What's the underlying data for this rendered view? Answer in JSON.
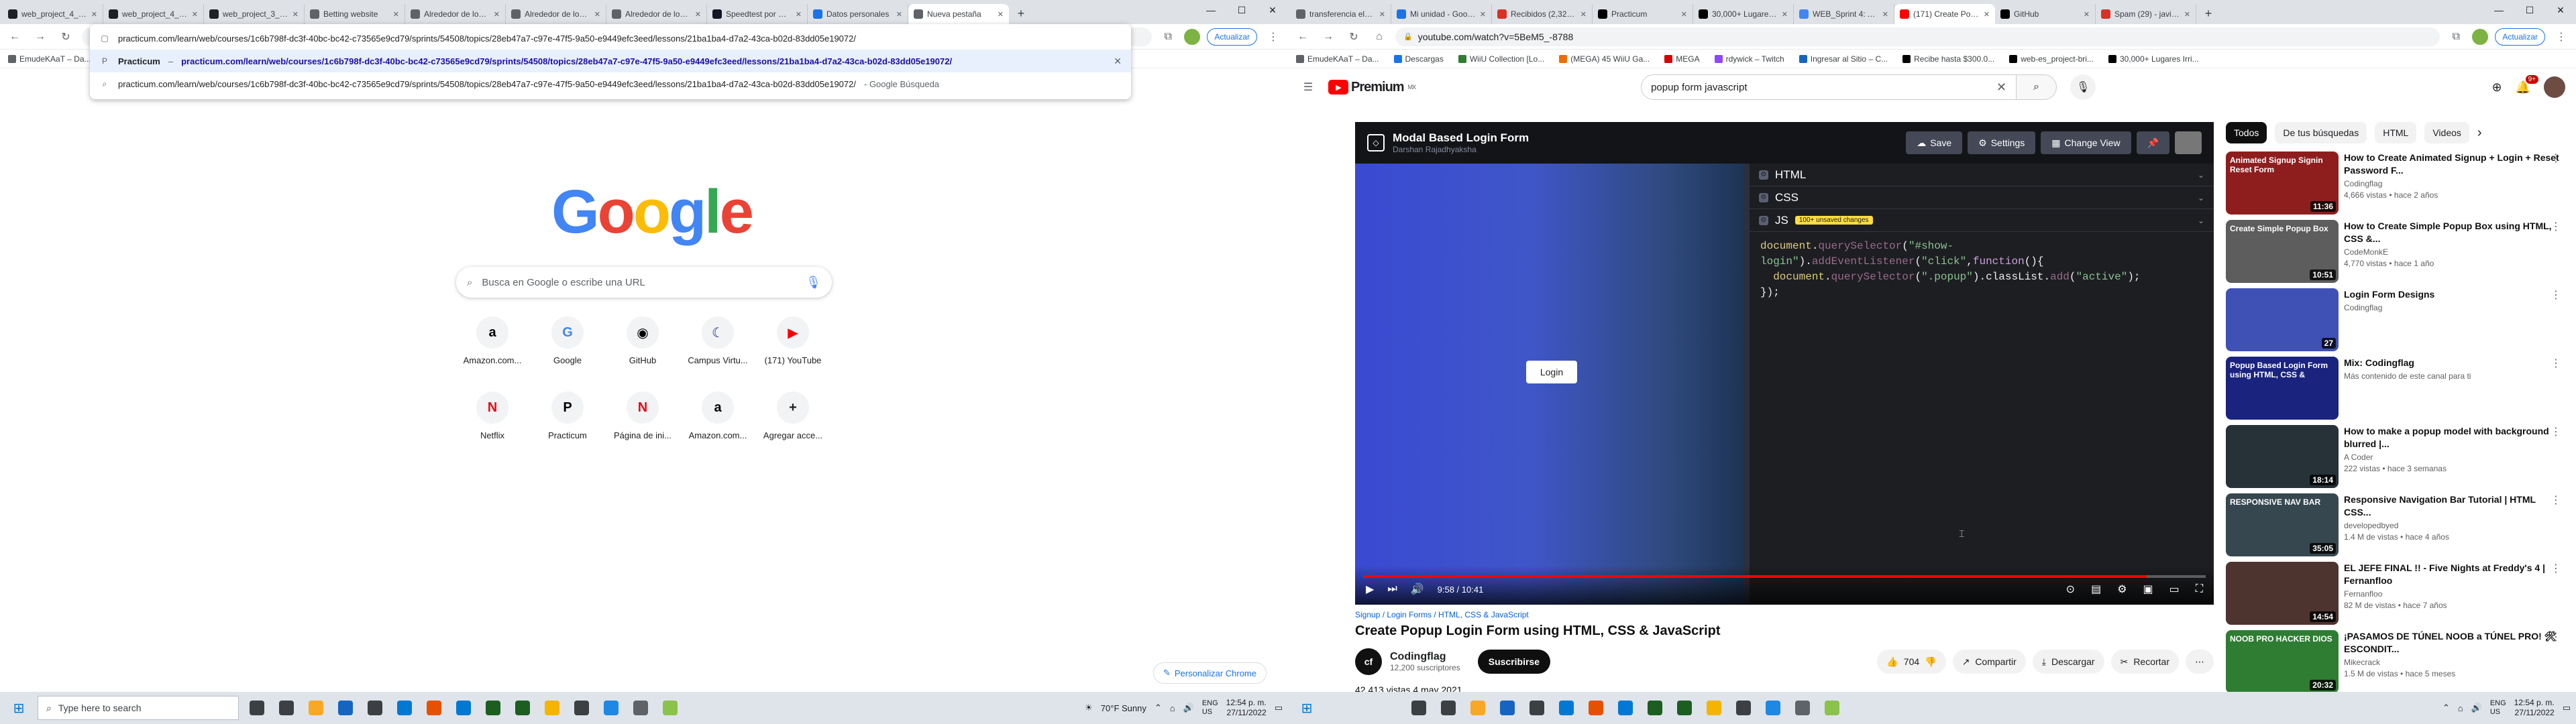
{
  "left": {
    "tabs": [
      {
        "title": "web_project_4_es...",
        "color": "#202124",
        "glyph": ""
      },
      {
        "title": "web_project_4_es...",
        "color": "#202124",
        "glyph": ""
      },
      {
        "title": "web_project_3_es...",
        "color": "#202124",
        "glyph": ""
      },
      {
        "title": "Betting website",
        "color": "#5f6368",
        "glyph": ""
      },
      {
        "title": "Alrededor de los E...",
        "color": "#5f6368",
        "glyph": ""
      },
      {
        "title": "Alrededor de los E...",
        "color": "#5f6368",
        "glyph": ""
      },
      {
        "title": "Alrededor de los E...",
        "color": "#5f6368",
        "glyph": ""
      },
      {
        "title": "Speedtest por Ook...",
        "color": "#141526",
        "glyph": ""
      },
      {
        "title": "Datos personales",
        "color": "#1a73e8",
        "glyph": ""
      },
      {
        "title": "Nueva pestaña",
        "color": "#5f6368",
        "glyph": ""
      }
    ],
    "omnibox_text": "practicum.com/learn/web/courses/1c6b798f-dc3f-40bc-bc42-c73565e9cd79/sprints/54508/topics/28eb47a7-c97e-47f5-9a50-e9449efc3eed/lessons/21ba1ba4-d7a2-43ca-b02d-83dd05e19072/",
    "dropdown": [
      {
        "icon": "P",
        "bold": "Practicum",
        "url": "practicum.com/learn/web/courses/1c6b798f-dc3f-40bc-bc42-c73565e9cd79/sprints/54508/topics/28eb47a7-c97e-47f5-9a50-e9449efc3eed/lessons/21ba1ba4-d7a2-43ca-b02d-83dd05e19072/",
        "dim": ""
      },
      {
        "icon": "⌕",
        "bold": "",
        "url": "practicum.com/learn/web/courses/1c6b798f-dc3f-40bc-bc42-c73565e9cd79/sprints/54508/topics/28eb47a7-c97e-47f5-9a50-e9449efc3eed/lessons/21ba1ba4-d7a2-43ca-b02d-83dd05e19072/",
        "dim": "- Google Búsqueda"
      }
    ],
    "bookmarks": [
      {
        "label": "EmudeKAaT – Da..."
      }
    ],
    "search_placeholder": "Busca en Google o escribe una URL",
    "shortcuts": [
      {
        "label": "Amazon.com...",
        "glyph": "a",
        "color": "#000"
      },
      {
        "label": "Google",
        "glyph": "G",
        "color": "#4285f4"
      },
      {
        "label": "GitHub",
        "glyph": "◉",
        "color": "#000"
      },
      {
        "label": "Campus Virtu...",
        "glyph": "☾",
        "color": "#1a237e"
      },
      {
        "label": "(171) YouTube",
        "glyph": "▶",
        "color": "#ff0000"
      },
      {
        "label": "Netflix",
        "glyph": "N",
        "color": "#e50914"
      },
      {
        "label": "Practicum",
        "glyph": "P",
        "color": "#000"
      },
      {
        "label": "Página de ini...",
        "glyph": "N",
        "color": "#e50914"
      },
      {
        "label": "Amazon.com...",
        "glyph": "a",
        "color": "#000"
      },
      {
        "label": "Agregar acce...",
        "glyph": "+",
        "color": "#202124"
      }
    ],
    "customize_label": "Personalizar Chrome",
    "update_label": "Actualizar"
  },
  "right": {
    "tabs": [
      {
        "title": "transferencia electrón...",
        "color": "#5f6368"
      },
      {
        "title": "Mi unidad - Google D...",
        "color": "#1a73e8"
      },
      {
        "title": "Recibidos (2,320) - ja...",
        "color": "#d93025"
      },
      {
        "title": "Practicum",
        "color": "#000"
      },
      {
        "title": "30,000+ Lugares Irrea...",
        "color": "#000"
      },
      {
        "title": "WEB_Sprint 4: Alrede...",
        "color": "#4285f4"
      },
      {
        "title": "(171) Create Popup L...",
        "color": "#ff0000"
      },
      {
        "title": "GitHub",
        "color": "#000"
      },
      {
        "title": "Spam (29) - javierca...",
        "color": "#d93025"
      }
    ],
    "omnibox_text": "youtube.com/watch?v=5BeM5_-8788",
    "update_label": "Actualizar",
    "bookmarks": [
      {
        "label": "EmudeKAaT – Da...",
        "color": "#5f6368"
      },
      {
        "label": "Descargas",
        "color": "#1a73e8"
      },
      {
        "label": "WiiU Collection [Lo...",
        "color": "#2e7d32"
      },
      {
        "label": "(MEGA) 45 WiiU Ga...",
        "color": "#ef6c00"
      },
      {
        "label": "MEGA",
        "color": "#d50000"
      },
      {
        "label": "rdywick – Twitch",
        "color": "#9146ff"
      },
      {
        "label": "Ingresar al Sitio – C...",
        "color": "#1565c0"
      },
      {
        "label": "Recibe hasta $300.0...",
        "color": "#000"
      },
      {
        "label": "web-es_project-bri...",
        "color": "#000"
      },
      {
        "label": "30,000+ Lugares Irri...",
        "color": "#000"
      }
    ],
    "search_query": "popup form javascript",
    "notif_count": "9+",
    "pen": {
      "title": "Modal Based Login Form",
      "author": "Darshan Rajadhyaksha",
      "save": "Save",
      "settings": "Settings",
      "change_view": "Change View",
      "panel_html": "HTML",
      "panel_css": "CSS",
      "panel_js": "JS",
      "unsaved": "100+ unsaved changes",
      "login_button": "Login"
    },
    "player": {
      "time": "9:58 / 10:41",
      "progress": 0.93
    },
    "video": {
      "tags": "Signup / Login Forms / HTML, CSS & JavaScript",
      "title": "Create Popup Login Form using HTML, CSS & JavaScript",
      "channel": "Codingflag",
      "channel_initials": "cf",
      "subs": "12,200 suscriptores",
      "subscribe": "Suscribirse",
      "likes": "704",
      "share": "Compartir",
      "download": "Descargar",
      "clip": "Recortar",
      "views": "42,413 vistas  4 may 2021"
    },
    "chips": [
      "Todos",
      "De tus búsquedas",
      "HTML",
      "Videos"
    ],
    "related": [
      {
        "title": "How to Create Animated Signup + Login + Reset Password F...",
        "channel": "Codingflag",
        "meta": "4,666 vistas • hace 2 años",
        "dur": "11:36",
        "thumb": "Animated Signup Signin Reset Form",
        "bg": "#8e1e1e"
      },
      {
        "title": "How to Create Simple Popup Box using HTML, CSS &...",
        "channel": "CodeMonkE",
        "meta": "4,770 vistas • hace 1 año",
        "dur": "10:51",
        "thumb": "Create Simple Popup Box",
        "bg": "#5d5d5d"
      },
      {
        "title": "Login Form Designs",
        "channel": "Codingflag",
        "meta": "",
        "dur": "27",
        "thumb": "",
        "bg": "#3f51b5"
      },
      {
        "title": "Mix: Codingflag",
        "channel": "Más contenido de este canal para ti",
        "meta": "",
        "dur": "",
        "thumb": "Popup Based Login Form using HTML, CSS &",
        "bg": "#1a237e"
      },
      {
        "title": "How to make a popup model with background blurred |...",
        "channel": "A Coder",
        "meta": "222 vistas • hace 3 semanas",
        "dur": "18:14",
        "thumb": "",
        "bg": "#263238"
      },
      {
        "title": "Responsive Navigation Bar Tutorial | HTML CSS...",
        "channel": "developedbyed",
        "meta": "1.4 M de vistas • hace 4 años",
        "dur": "35:05",
        "thumb": "RESPONSIVE NAV BAR",
        "bg": "#37474f"
      },
      {
        "title": "EL JEFE FINAL !! - Five Nights at Freddy's 4 | Fernanfloo",
        "channel": "Fernanfloo",
        "meta": "82 M de vistas • hace 7 años",
        "dur": "14:54",
        "thumb": "",
        "bg": "#4e342e"
      },
      {
        "title": "¡PASAMOS DE TÚNEL NOOB a TÚNEL PRO! 🛠 ESCONDIT...",
        "channel": "Mikecrack",
        "meta": "1.5 M de vistas • hace 5 meses",
        "dur": "20:32",
        "thumb": "NOOB PRO HACKER DIOS",
        "bg": "#2e7d32"
      }
    ]
  },
  "taskbar_left": {
    "search_placeholder": "Type here to search",
    "weather": "70°F  Sunny",
    "lang": "ENG",
    "region": "US",
    "time": "12:54 p. m.",
    "date": "27/11/2022"
  },
  "taskbar_right": {
    "lang": "ENG",
    "region": "US",
    "time": "12:54 p. m.",
    "date": "27/11/2022"
  },
  "taskbar_apps": [
    "#3c4043",
    "#3c4043",
    "#f9a825",
    "#1565c0",
    "#3c4043",
    "#0078d4",
    "#e65100",
    "#0078d4",
    "#1b5e20",
    "#1b5e20",
    "#f4b400",
    "#3c4043",
    "#1e88e5",
    "#5f6368",
    "#8bc34a"
  ]
}
